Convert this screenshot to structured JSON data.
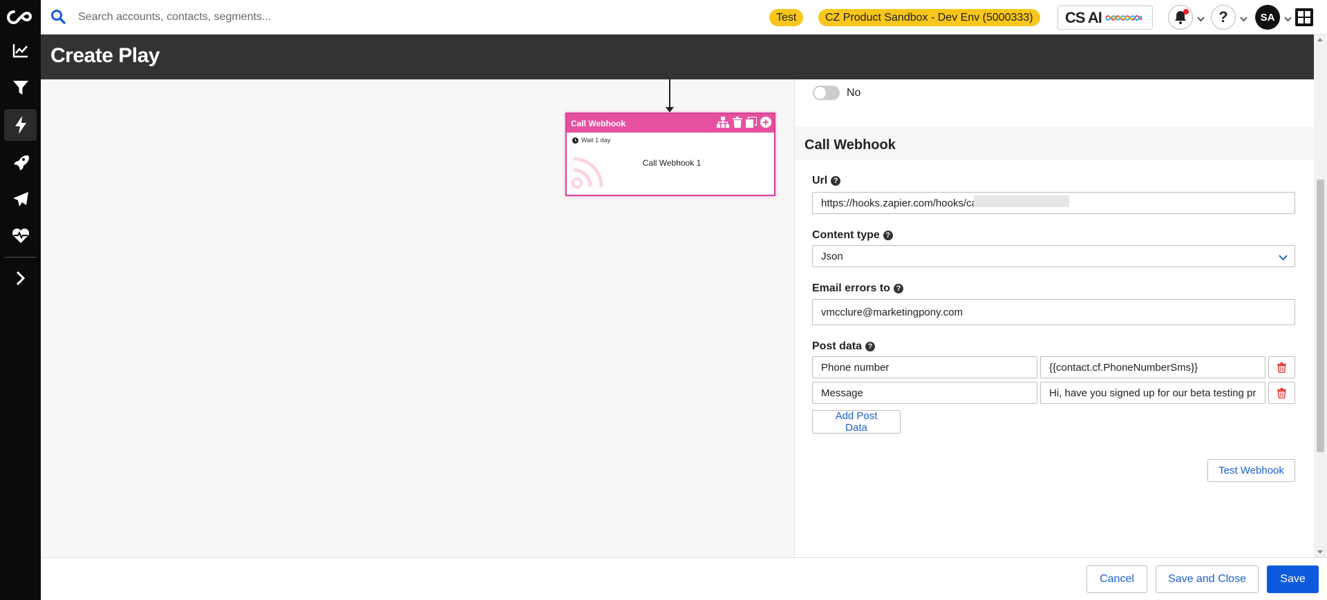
{
  "search": {
    "placeholder": "Search accounts, contacts, segments..."
  },
  "header": {
    "test_badge": "Test",
    "env_badge": "CZ Product Sandbox - Dev Env (5000333)",
    "csai_label": "CS AI",
    "avatar_initials": "SA"
  },
  "page": {
    "title": "Create Play"
  },
  "node": {
    "header_label": "Call Webhook",
    "wait_label": "Wait 1 day",
    "body_label": "Call Webhook 1"
  },
  "panel": {
    "toggle_value": "No",
    "section_title": "Call Webhook",
    "url_label": "Url",
    "url_value": "https://hooks.zapier.com/hooks/catch/",
    "content_type_label": "Content type",
    "content_type_value": "Json",
    "email_errors_label": "Email errors to",
    "email_errors_value": "vmcclure@marketingpony.com",
    "post_data_label": "Post data",
    "post_data": [
      {
        "key": "Phone number",
        "value": "{{contact.cf.PhoneNumberSms}}"
      },
      {
        "key": "Message",
        "value": "Hi, have you signed up for our beta testing pro"
      }
    ],
    "add_post_data_label": "Add Post Data",
    "test_webhook_label": "Test Webhook"
  },
  "footer": {
    "cancel_label": "Cancel",
    "save_close_label": "Save and Close",
    "save_label": "Save"
  },
  "colors": {
    "node_header": "#e5509f",
    "badge": "#f8c61c",
    "primary": "#0d5bdd",
    "link": "#1a5fd0",
    "danger": "#e0302a"
  }
}
